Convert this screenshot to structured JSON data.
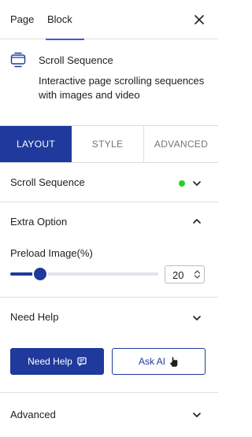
{
  "top_tabs": {
    "page_label": "Page",
    "block_label": "Block",
    "active": "Block"
  },
  "block": {
    "icon": "scroll-sequence-icon",
    "title": "Scroll Sequence",
    "description": "Interactive page scrolling sequences with images and video"
  },
  "layout_tabs": {
    "layout": "LAYOUT",
    "style": "STYLE",
    "advanced": "ADVANCED",
    "active": "LAYOUT"
  },
  "panels": {
    "scroll_sequence": {
      "label": "Scroll Sequence",
      "status": "active",
      "status_color": "#26d026"
    },
    "extra_option": {
      "label": "Extra Option",
      "expanded": true,
      "preload": {
        "label": "Preload Image(%)",
        "value": "20",
        "min": 0,
        "max": 100
      }
    },
    "need_help": {
      "label": "Need Help",
      "help_button": "Need Help",
      "ask_ai_button": "Ask AI"
    },
    "advanced": {
      "label": "Advanced"
    }
  },
  "colors": {
    "accent": "#1f3a9c",
    "wp_blue": "#3858e9",
    "status_green": "#26d026"
  }
}
